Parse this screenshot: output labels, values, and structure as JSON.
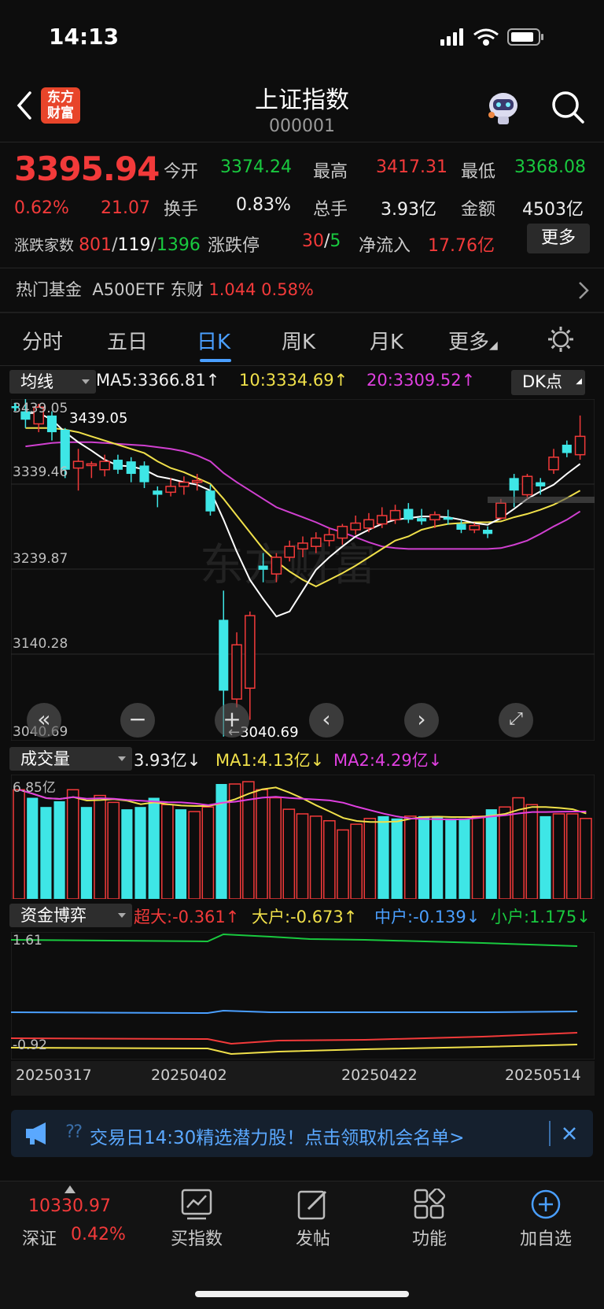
{
  "status": {
    "time": "14:13"
  },
  "header": {
    "title": "上证指数",
    "code": "000001",
    "logo_line1": "东方",
    "logo_line2": "财富"
  },
  "quote": {
    "price": "3395.94",
    "change_pct": "0.62%",
    "change": "21.07",
    "open_label": "今开",
    "open": "3374.24",
    "high_label": "最高",
    "high": "3417.31",
    "low_label": "最低",
    "low": "3368.08",
    "turnover_label": "换手",
    "turnover": "0.83%",
    "volume_label": "总手",
    "volume": "3.93亿",
    "amount_label": "金额",
    "amount": "4503亿",
    "breadth_label": "涨跌家数",
    "breadth_up": "801",
    "breadth_flat": "119",
    "breadth_down": "1396",
    "slash": "/",
    "limit_label": "涨跌停",
    "limit_up": "30",
    "limit_down": "5",
    "netflow_label": "净流入",
    "netflow": "17.76亿",
    "more_label": "更多"
  },
  "fund": {
    "label": "热门基金",
    "name": "A500ETF 东财",
    "price": "1.044",
    "pct": "0.58%"
  },
  "tabs": [
    "分时",
    "五日",
    "日K",
    "周K",
    "月K",
    "更多"
  ],
  "kline": {
    "selector": "均线",
    "ma5": "MA5:3366.81↑",
    "ma10": "10:3334.69↑",
    "ma20": "20:3309.52↑",
    "dk": "DK点",
    "y_labels": [
      "3339.46",
      "3239.87",
      "3140.28",
      "3040.69"
    ],
    "top_label": "3439.05",
    "top_axis": "3439.05",
    "high_mark": "3439.05",
    "low_mark": "←3040.69",
    "watermark": "东方财富"
  },
  "volume_panel": {
    "selector": "成交量",
    "vol": "3.93亿↓",
    "ma1": "MA1:4.13亿↓",
    "ma2": "MA2:4.29亿↓",
    "top": "6.85亿"
  },
  "fund_panel": {
    "selector": "资金博弈",
    "super": "超大:-0.361↑",
    "big": "大户:-0.673↑",
    "mid": "中户:-0.139↓",
    "small": "小户:1.175↓",
    "top": "1.61",
    "bottom": "-0.92"
  },
  "dates": [
    "20250317",
    "20250402",
    "20250422",
    "20250514"
  ],
  "banner": {
    "text": "交易日14:30精选潜力股！点击领取机会名单>"
  },
  "bottom_nav": {
    "index_value": "10330.97",
    "index_name": "深证",
    "index_pct": "0.42%",
    "items": [
      "买指数",
      "发帖",
      "功能",
      "加自选"
    ]
  },
  "chart_data": {
    "type": "candlestick",
    "ylim": [
      3040.69,
      3439.05
    ],
    "candles": [
      {
        "o": 3430,
        "c": 3420,
        "h": 3445,
        "l": 3410
      },
      {
        "o": 3415,
        "c": 3435,
        "h": 3439,
        "l": 3405
      },
      {
        "o": 3425,
        "c": 3405,
        "h": 3430,
        "l": 3395
      },
      {
        "o": 3408,
        "c": 3360,
        "h": 3410,
        "l": 3350
      },
      {
        "o": 3362,
        "c": 3370,
        "h": 3385,
        "l": 3335
      },
      {
        "o": 3365,
        "c": 3367,
        "h": 3370,
        "l": 3350
      },
      {
        "o": 3360,
        "c": 3370,
        "h": 3378,
        "l": 3352
      },
      {
        "o": 3372,
        "c": 3360,
        "h": 3378,
        "l": 3355
      },
      {
        "o": 3370,
        "c": 3355,
        "h": 3375,
        "l": 3345
      },
      {
        "o": 3365,
        "c": 3345,
        "h": 3370,
        "l": 3338
      },
      {
        "o": 3335,
        "c": 3330,
        "h": 3340,
        "l": 3315
      },
      {
        "o": 3333,
        "c": 3340,
        "h": 3350,
        "l": 3328
      },
      {
        "o": 3340,
        "c": 3345,
        "h": 3352,
        "l": 3330
      },
      {
        "o": 3345,
        "c": 3347,
        "h": 3355,
        "l": 3335
      },
      {
        "o": 3335,
        "c": 3310,
        "h": 3342,
        "l": 3305
      },
      {
        "o": 3180,
        "c": 3095,
        "h": 3215,
        "l": 3040
      },
      {
        "o": 3085,
        "c": 3150,
        "h": 3165,
        "l": 3075
      },
      {
        "o": 3098,
        "c": 3185,
        "h": 3190,
        "l": 3060
      },
      {
        "o": 3245,
        "c": 3240,
        "h": 3260,
        "l": 3225
      },
      {
        "o": 3235,
        "c": 3255,
        "h": 3260,
        "l": 3225
      },
      {
        "o": 3255,
        "c": 3268,
        "h": 3275,
        "l": 3250
      },
      {
        "o": 3265,
        "c": 3272,
        "h": 3280,
        "l": 3255
      },
      {
        "o": 3268,
        "c": 3278,
        "h": 3285,
        "l": 3260
      },
      {
        "o": 3275,
        "c": 3282,
        "h": 3290,
        "l": 3268
      },
      {
        "o": 3278,
        "c": 3292,
        "h": 3295,
        "l": 3270
      },
      {
        "o": 3288,
        "c": 3296,
        "h": 3305,
        "l": 3282
      },
      {
        "o": 3290,
        "c": 3300,
        "h": 3308,
        "l": 3285
      },
      {
        "o": 3295,
        "c": 3305,
        "h": 3315,
        "l": 3290
      },
      {
        "o": 3300,
        "c": 3311,
        "h": 3318,
        "l": 3295
      },
      {
        "o": 3313,
        "c": 3300,
        "h": 3320,
        "l": 3296
      },
      {
        "o": 3302,
        "c": 3298,
        "h": 3313,
        "l": 3294
      },
      {
        "o": 3300,
        "c": 3306,
        "h": 3310,
        "l": 3290
      },
      {
        "o": 3303,
        "c": 3300,
        "h": 3312,
        "l": 3294
      },
      {
        "o": 3295,
        "c": 3288,
        "h": 3300,
        "l": 3284
      },
      {
        "o": 3288,
        "c": 3293,
        "h": 3296,
        "l": 3284
      },
      {
        "o": 3288,
        "c": 3283,
        "h": 3292,
        "l": 3278
      },
      {
        "o": 3302,
        "c": 3320,
        "h": 3325,
        "l": 3300
      },
      {
        "o": 3350,
        "c": 3335,
        "h": 3355,
        "l": 3315
      },
      {
        "o": 3330,
        "c": 3352,
        "h": 3355,
        "l": 3325
      },
      {
        "o": 3345,
        "c": 3340,
        "h": 3350,
        "l": 3330
      },
      {
        "o": 3360,
        "c": 3375,
        "h": 3385,
        "l": 3355
      },
      {
        "o": 3390,
        "c": 3380,
        "h": 3395,
        "l": 3375
      },
      {
        "o": 3378,
        "c": 3400,
        "h": 3425,
        "l": 3372
      }
    ],
    "ma5": [
      3428,
      3428,
      3420,
      3405,
      3393,
      3383,
      3372,
      3365,
      3364,
      3360,
      3352,
      3349,
      3345,
      3342,
      3335,
      3300,
      3262,
      3228,
      3205,
      3184,
      3190,
      3215,
      3240,
      3255,
      3268,
      3280,
      3288,
      3295,
      3300,
      3302,
      3304,
      3304,
      3303,
      3300,
      3296,
      3294,
      3302,
      3313,
      3325,
      3334,
      3342,
      3355,
      3367
    ],
    "ma10": [
      3410,
      3410,
      3410,
      3408,
      3405,
      3400,
      3395,
      3390,
      3385,
      3380,
      3370,
      3362,
      3357,
      3350,
      3343,
      3325,
      3305,
      3285,
      3265,
      3250,
      3238,
      3228,
      3220,
      3228,
      3236,
      3245,
      3255,
      3265,
      3275,
      3280,
      3288,
      3292,
      3295,
      3296,
      3297,
      3297,
      3298,
      3303,
      3307,
      3312,
      3318,
      3326,
      3335
    ],
    "ma20": [
      3388,
      3390,
      3392,
      3393,
      3393,
      3393,
      3392,
      3391,
      3390,
      3389,
      3387,
      3385,
      3382,
      3377,
      3370,
      3356,
      3345,
      3335,
      3325,
      3315,
      3309,
      3303,
      3297,
      3290,
      3285,
      3279,
      3273,
      3268,
      3266,
      3265,
      3265,
      3265,
      3265,
      3265,
      3265,
      3265,
      3266,
      3270,
      3275,
      3283,
      3292,
      3300,
      3310
    ],
    "volume_ratio": [
      0.95,
      0.88,
      0.8,
      0.85,
      0.95,
      0.8,
      0.9,
      0.84,
      0.78,
      0.8,
      0.88,
      0.82,
      0.78,
      0.76,
      0.8,
      1.0,
      1.0,
      1.02,
      0.95,
      0.88,
      0.78,
      0.74,
      0.72,
      0.68,
      0.6,
      0.65,
      0.7,
      0.72,
      0.7,
      0.72,
      0.72,
      0.72,
      0.7,
      0.7,
      0.72,
      0.78,
      0.8,
      0.88,
      0.82,
      0.72,
      0.74,
      0.74,
      0.7
    ],
    "volume_up": [
      1,
      0,
      0,
      0,
      1,
      0,
      1,
      1,
      0,
      0,
      0,
      1,
      0,
      1,
      1,
      0,
      1,
      1,
      1,
      1,
      1,
      1,
      1,
      1,
      1,
      1,
      1,
      0,
      0,
      1,
      0,
      0,
      0,
      0,
      1,
      0,
      1,
      1,
      1,
      0,
      1,
      1,
      1
    ]
  }
}
